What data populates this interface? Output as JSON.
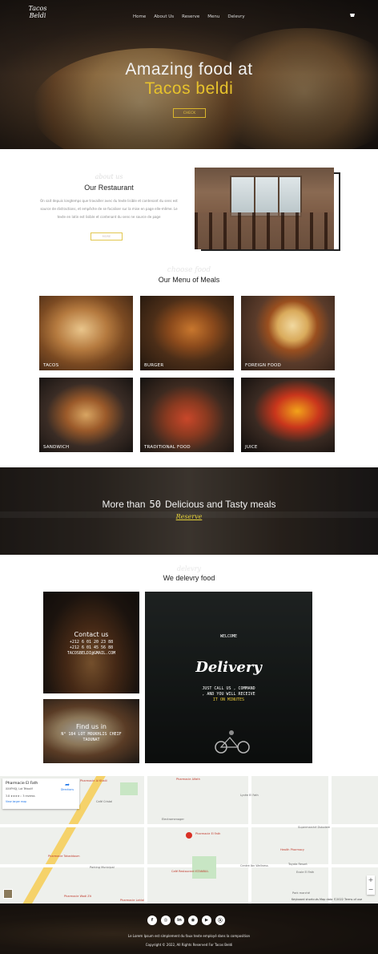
{
  "hero": {
    "logo_line1": "Tacos",
    "logo_line2": "Beldi",
    "nav": [
      "Home",
      "About Us",
      "Reserve",
      "Menu",
      "Delevry"
    ],
    "title_line1": "Amazing food at",
    "title_line2": "Tacos beldi",
    "button": "CHECK"
  },
  "about": {
    "script": "about us",
    "title": "Our Restaurant",
    "text": "On sait depuis longtemps que travailler avec du texte lisible et contenant du sens est source de distractions, et empêche de se focaliser sur la mise en page elle-même. Le texte en latin est lisible et contenant du sens ne source de page",
    "button": "MORE"
  },
  "menu": {
    "script": "choose food",
    "title": "Our Menu of Meals",
    "items": [
      "TACOS",
      "BURGER",
      "FOREIGN FOOD",
      "SANDWICH",
      "TRADITIONAL FOOD",
      "JUICE"
    ]
  },
  "band": {
    "text_before": "More than",
    "count": "50",
    "text_after": "Delicious and Tasty meals",
    "button": "Reserve"
  },
  "delivery": {
    "script": "delevry",
    "title": "We delevry food",
    "contact_title": "Contact us",
    "contact_phone1": "+212 6 01 20 23 88",
    "contact_phone2": "+212 6 01 45 56 88",
    "contact_email": "TACOSBELDI@GMAIL.COM",
    "find_title": "Find us in",
    "find_address1": "N° 184 LOT MOUKHLIS CHEIF",
    "find_address2": "TAOUNAT",
    "welcome": "WELCOME",
    "big_word": "Delivery",
    "cta_line1": "JUST CALL US , COMMAND",
    "cta_line2": ", AND YOU WILL RECEIVE",
    "cta_line3": "IT ON MINUTES"
  },
  "map": {
    "place_name": "Pharmacie El Fath",
    "place_address": "XXXPHQJ, Lot Tétaolif",
    "rating": "3.8 ★★★★☆  3 reviews",
    "view_larger": "View larger map",
    "directions": "Directions",
    "labels": [
      "Pharmacie Al Khalil",
      "Pharmacie Alfath",
      "Café Cristal",
      "Lycée El Fath",
      "Pharmacie El Fath",
      "Health Pharmacy",
      "Café Restaurant ISTANBUL",
      "Pharmacie Takaddoum",
      "Pharmacie Lahlal",
      "Pharmacie Wadi Zit",
      "Parking Municipal",
      "Electromenager",
      "Centre Ibn Wellness",
      "Toyota Resort",
      "Ecole El Fath",
      "Park marché",
      "Supermarché Dstodem"
    ],
    "map_footer": "Keyboard shortcuts  Map data ©2022  Terms of use"
  },
  "footer": {
    "socials": [
      "f",
      "◎",
      "in",
      "◉",
      "▶",
      "⦿"
    ],
    "line1": "Le Lorem Ipsum est simplement du faux texte employé dans la composition",
    "line2": "Copyright © 2022, All Rights Reserved For Tacos Beldi"
  }
}
